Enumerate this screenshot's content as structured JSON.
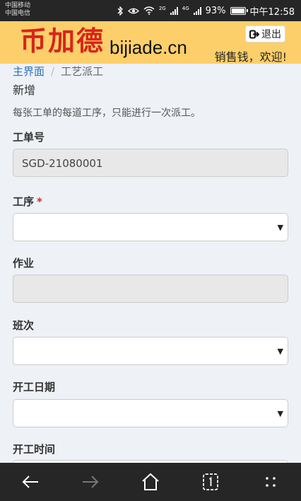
{
  "statusbar": {
    "carrier1": "中国移动",
    "carrier2": "中国电信",
    "net1": "2G",
    "net2": "4G",
    "battery_text": "93%",
    "battery_level": 0.93,
    "time": "中午12:58"
  },
  "header": {
    "logo_cn": "币加德",
    "logo_en": "bijiade.cn",
    "logout_label": "退出",
    "welcome": "销售钱，欢迎!"
  },
  "breadcrumb": {
    "home": "主界面",
    "separator": "/",
    "current": "工艺派工"
  },
  "page": {
    "title": "新增",
    "hint": "每张工单的每道工序，只能进行一次派工。"
  },
  "form": {
    "order_no": {
      "label": "工单号",
      "value": "SGD-21080001"
    },
    "process": {
      "label": "工序",
      "required_mark": "*",
      "value": ""
    },
    "job": {
      "label": "作业",
      "value": ""
    },
    "shift": {
      "label": "班次",
      "value": ""
    },
    "start_date": {
      "label": "开工日期",
      "value": ""
    },
    "start_time": {
      "label": "开工时间"
    }
  },
  "icons": {
    "back": "arrow-left-icon",
    "forward": "arrow-right-icon",
    "home": "home-icon",
    "tabs": "tabs-icon",
    "menu": "menu-icon"
  },
  "colors": {
    "header_bg": "#fccf6a",
    "logo_red": "#d9241b",
    "link_blue": "#2e73b8",
    "required_red": "#c9302c",
    "system_bar": "#262626"
  }
}
